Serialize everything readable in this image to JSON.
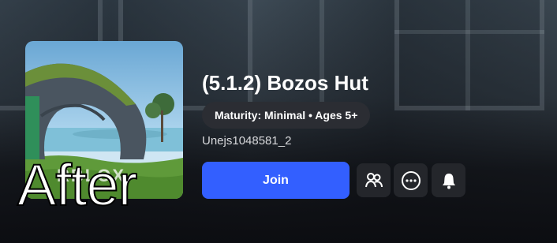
{
  "game": {
    "title": "(5.1.2) Bozos Hut",
    "maturity": "Maturity: Minimal • Ages 5+",
    "creator": "Unejs1048581_2",
    "thumbnail_text": "RBLOX"
  },
  "actions": {
    "join_label": "Join",
    "party_icon": "party-icon",
    "more_icon": "more-options-icon",
    "notify_icon": "bell-icon"
  },
  "overlay": {
    "text": "After"
  },
  "colors": {
    "join_button": "#335fff",
    "icon_button": "#24262b",
    "maturity_pill": "#2b2d33"
  }
}
